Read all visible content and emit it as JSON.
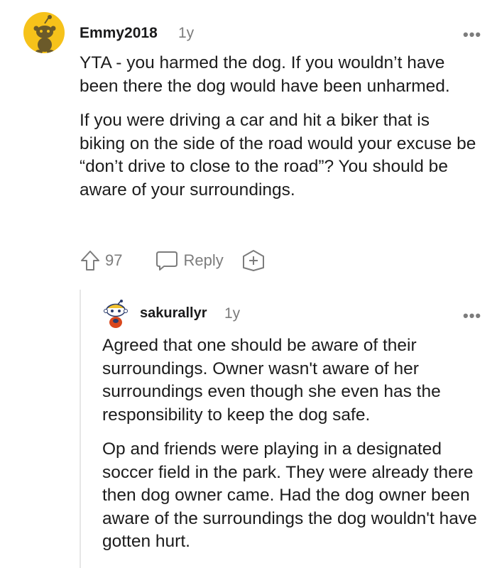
{
  "comments": [
    {
      "username": "Emmy2018",
      "age": "1y",
      "more_label": "•••",
      "paragraphs": [
        "YTA - you harmed the dog. If you wouldn’t have been there the dog would have been unharmed.",
        "If you were driving a car and hit a biker that is biking on the side of the road would your excuse be “don’t drive to close to the road”? You should be aware of your surroundings."
      ],
      "votes": "97",
      "reply_label": "Reply",
      "icons": [
        "upvote-icon",
        "reply-bubble-icon",
        "award-plus-icon",
        "snoo-avatar"
      ]
    },
    {
      "username": "sakurallyr",
      "age": "1y",
      "more_label": "•••",
      "paragraphs": [
        "Agreed that one should be aware of their surroundings. Owner wasn't aware of her surroundings even though she even has the responsibility to keep the dog safe.",
        "Op and friends were playing in a designated soccer field in the park. They were already there then dog owner came. Had the dog owner been aware of the surroundings the dog wouldn't have gotten hurt."
      ],
      "icons": [
        "snoo-avatar"
      ]
    }
  ],
  "colors": {
    "avatar_yellow": "#f6c21a",
    "text": "#1c1c1c",
    "meta_gray": "#7c7c7c",
    "thread_line": "#e6e6e6"
  }
}
